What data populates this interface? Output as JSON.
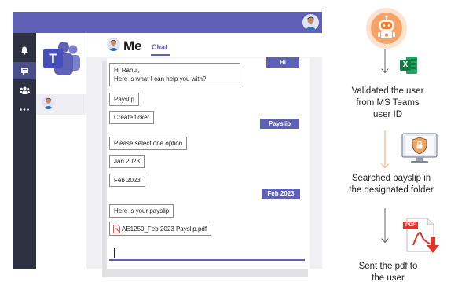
{
  "teams": {
    "title": "Me",
    "tab": "Chat",
    "messages": {
      "greeting_line1": "Hi Rahul,",
      "greeting_line2": "Here is what I can help you with?",
      "payslip_option": "Payslip",
      "ticket_option": "Create ticket",
      "select_prompt": "Please select one option",
      "month_jan": "Jan 2023",
      "month_feb": "Feb 2023",
      "result": "Here is your payslip",
      "attachment": "AE1250_Feb 2023 Payslip.pdf"
    },
    "replies": {
      "hi": "Hi",
      "payslip": "Payslip",
      "feb": "Feb 2023"
    },
    "teams_logo_letter": "T",
    "accent": "#5e61b5"
  },
  "flow": {
    "excel_letter": "X",
    "pdf_badge": "PDF",
    "step1_line1": "Validated the user",
    "step1_line2": "from MS Teams",
    "step1_line3": "user ID",
    "step2_line1": "Searched payslip in",
    "step2_line2": "the designated folder",
    "step3_line1": "Sent the pdf to",
    "step3_line2": "the user",
    "arrow_color": "#f39c55"
  }
}
